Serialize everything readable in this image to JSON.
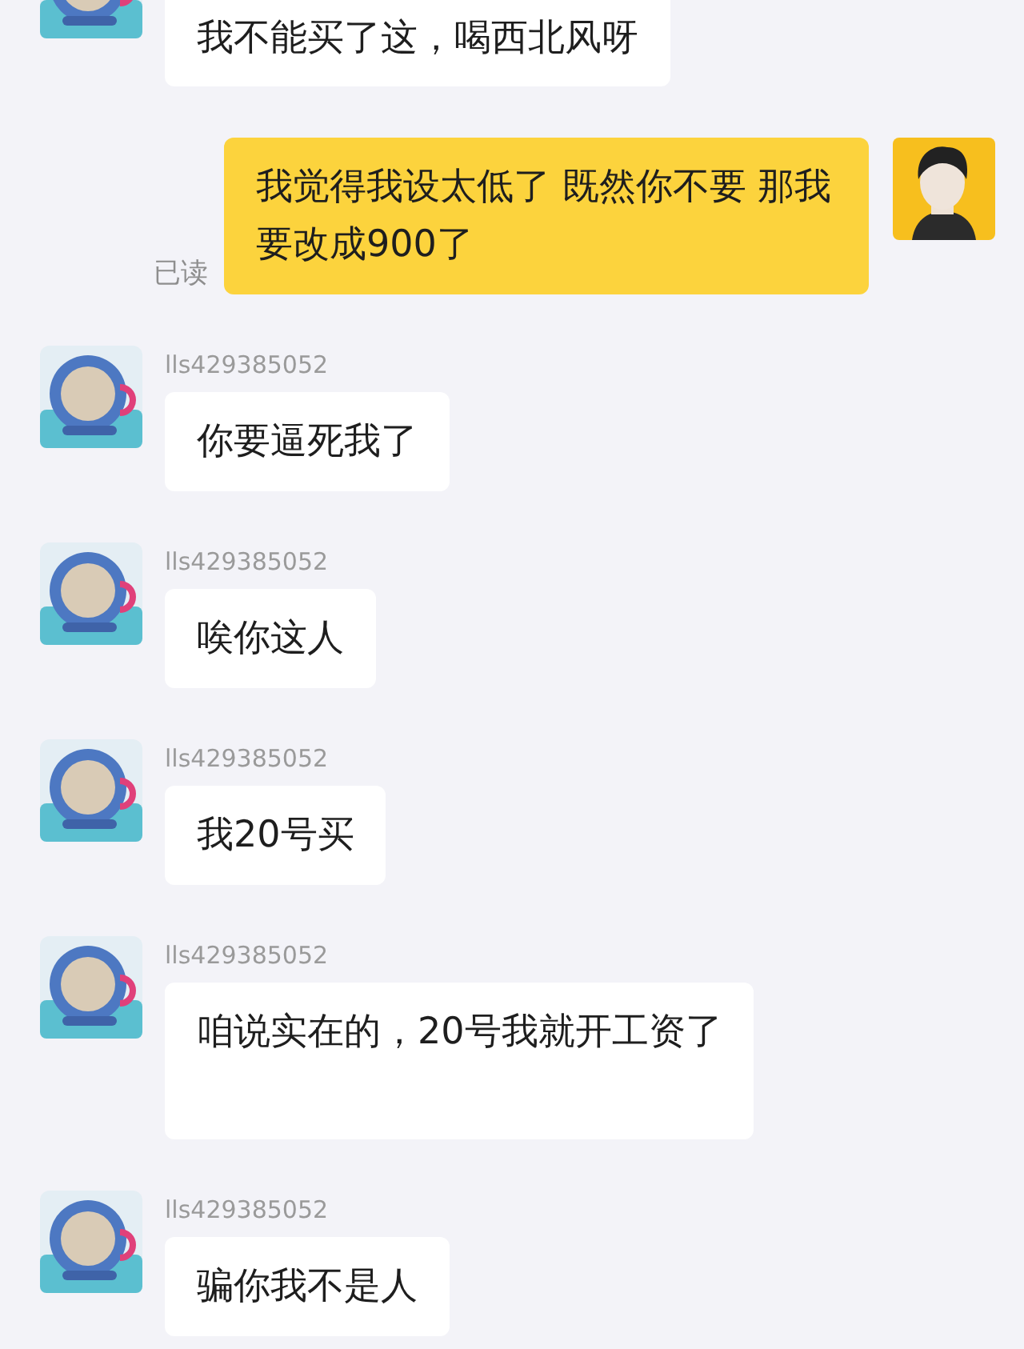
{
  "messages": [
    {
      "kind": "incoming",
      "text": "我不能买了这，喝西北风呀",
      "cut_top": true
    },
    {
      "kind": "outgoing",
      "text": "我觉得我设太低了 既然你不要 那我要改成900了",
      "receipt": "已读"
    },
    {
      "kind": "incoming",
      "sender": "lls429385052",
      "text": "你要逼死我了"
    },
    {
      "kind": "incoming",
      "sender": "lls429385052",
      "text": "唉你这人"
    },
    {
      "kind": "incoming",
      "sender": "lls429385052",
      "text": "我20号买"
    },
    {
      "kind": "incoming",
      "sender": "lls429385052",
      "text": "咱说实在的，20号我就开工资了",
      "blank_line": true
    },
    {
      "kind": "incoming",
      "sender": "lls429385052",
      "text": "骗你我不是人"
    }
  ]
}
